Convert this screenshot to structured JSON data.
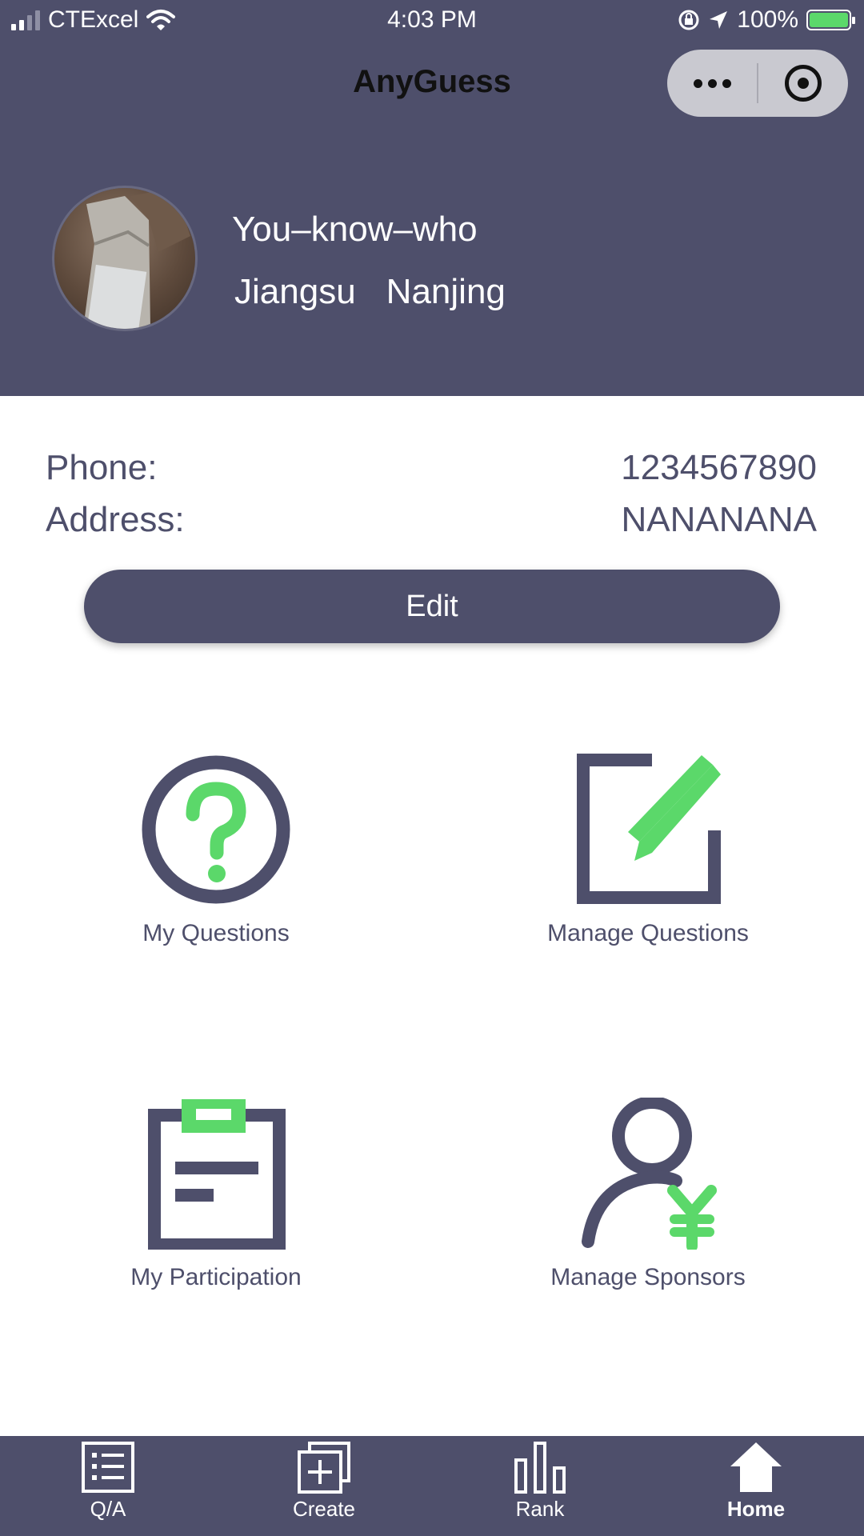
{
  "status_bar": {
    "carrier": "CTExcel",
    "time": "4:03 PM",
    "battery": "100%"
  },
  "nav": {
    "title": "AnyGuess"
  },
  "profile": {
    "name": "You–know–who",
    "province": "Jiangsu",
    "city": "Nanjing"
  },
  "info": {
    "phone_label": "Phone:",
    "phone_value": "1234567890",
    "address_label": "Address:",
    "address_value": "NANANANA"
  },
  "edit_label": "Edit",
  "grid": {
    "my_questions": "My Questions",
    "manage_questions": "Manage Questions",
    "my_participation": "My Participation",
    "manage_sponsors": "Manage Sponsors"
  },
  "tabs": {
    "qa": "Q/A",
    "create": "Create",
    "rank": "Rank",
    "home": "Home"
  },
  "colors": {
    "primary": "#4e4f6b",
    "accent": "#5bd86a",
    "capsule": "#c9c9d0"
  }
}
